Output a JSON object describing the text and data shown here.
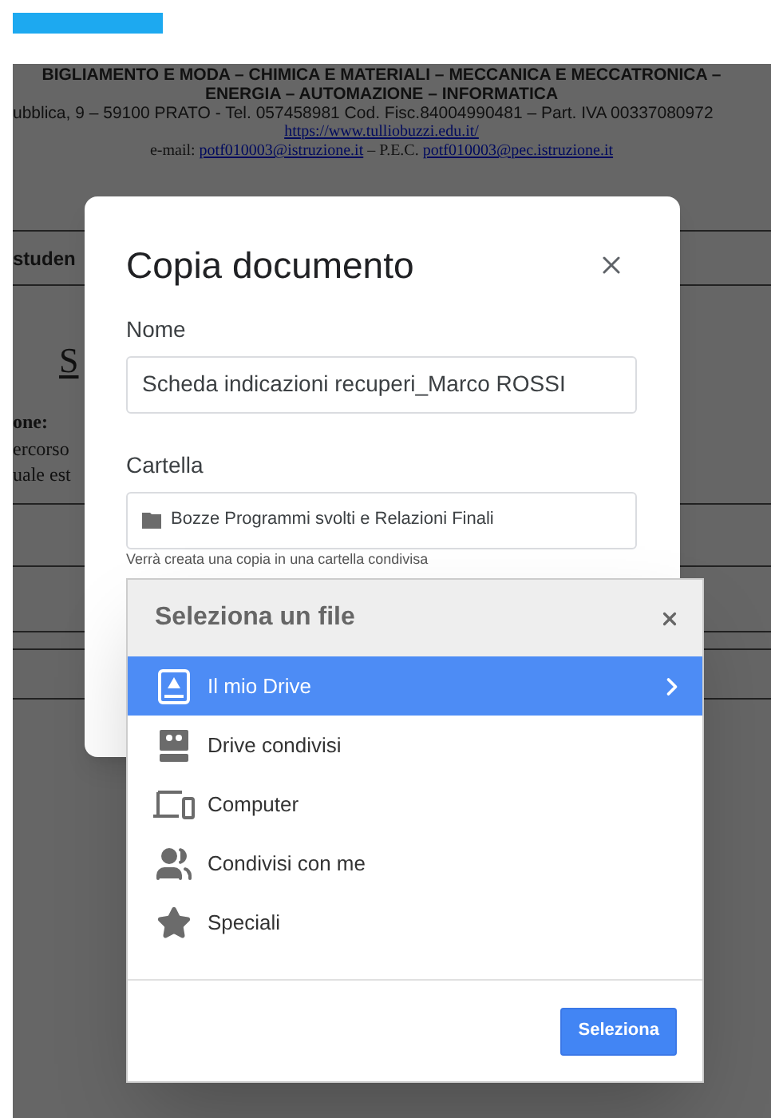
{
  "document": {
    "header_lines": [
      [
        {
          "kind": "text",
          "text": "BIGLIAMENTO E MODA – CHIMICA E MATERIALI – MECCANICA E MECCATRONICA –"
        }
      ],
      [
        {
          "kind": "text",
          "text": "ENERGIA – AUTOMAZIONE – INFORMATICA"
        }
      ],
      [
        {
          "kind": "text",
          "text": "ubblica, 9 – 59100 PRATO - Tel. 057458981 Cod. Fisc.84004990481 – Part. IVA  00337080972"
        }
      ],
      [
        {
          "kind": "link",
          "text": "https://www.tulliobuzzi.edu.it/"
        }
      ],
      [
        {
          "kind": "text",
          "text": "e-mail: "
        },
        {
          "kind": "link",
          "text": "potf010003@istruzione.it"
        },
        {
          "kind": "text",
          "text": " – P.E.C. "
        },
        {
          "kind": "link",
          "text": "potf010003@pec.istruzione.it"
        }
      ]
    ],
    "table_label": "studen",
    "heading": "S",
    "section_label": "one:",
    "body_lines": [
      "ercorso",
      "uale est"
    ]
  },
  "dialog": {
    "title": "Copia documento",
    "name_label": "Nome",
    "name_value": "Scheda indicazioni recuperi_Marco ROSSI",
    "folder_label": "Cartella",
    "folder_value": "Bozze Programmi svolti e Relazioni Finali",
    "hint": "Verrà creata una copia in una cartella condivisa"
  },
  "picker": {
    "title": "Seleziona un file",
    "items": [
      {
        "kind": "my-drive",
        "label": "Il mio Drive",
        "selected": true
      },
      {
        "kind": "shared-drives",
        "label": "Drive condivisi",
        "selected": false
      },
      {
        "kind": "computer",
        "label": "Computer",
        "selected": false
      },
      {
        "kind": "shared-with-me",
        "label": "Condivisi con me",
        "selected": false
      },
      {
        "kind": "starred",
        "label": "Speciali",
        "selected": false
      }
    ],
    "button": "Seleziona"
  }
}
